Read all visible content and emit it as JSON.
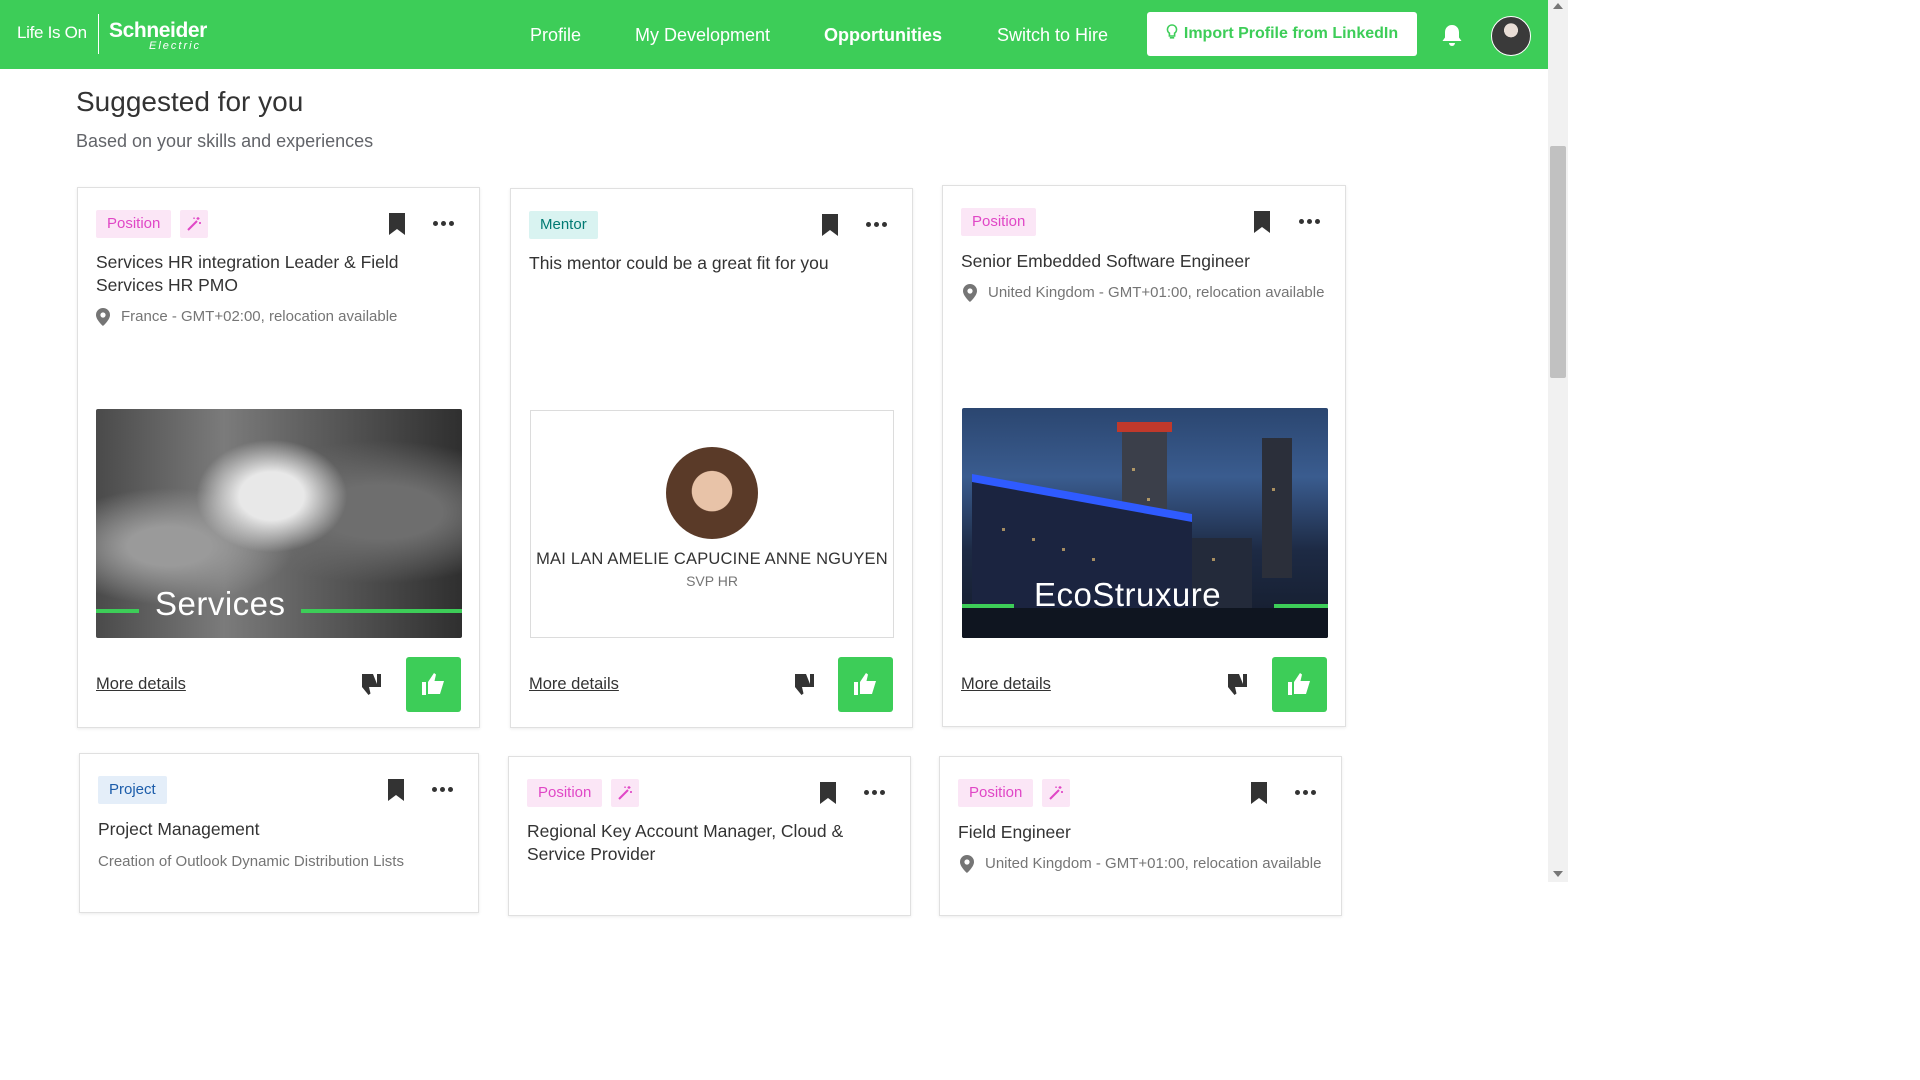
{
  "nav": {
    "brand_tagline": "Life Is On",
    "brand_name": "Schneider",
    "brand_sub": "Electric",
    "items": [
      {
        "label": "Profile"
      },
      {
        "label": "My Development"
      },
      {
        "label": "Opportunities"
      },
      {
        "label": "Switch to Hire"
      }
    ],
    "active_item": "Opportunities",
    "import_button": "Import Profile from LinkedIn",
    "accent_color": "#3dcd58"
  },
  "section": {
    "title": "Suggested for you",
    "subtitle": "Based on your skills and experiences"
  },
  "cards": [
    {
      "badge": "Position",
      "title": "Services HR integration Leader & Field Services HR PMO",
      "location": "France - GMT+02:00, relocation available",
      "image_text": "Services",
      "more_details": "More details"
    },
    {
      "badge": "Mentor",
      "title": "This mentor could be a great fit for you",
      "mentor_name": "MAI LAN AMELIE CAPUCINE ANNE NGUYEN",
      "mentor_role": "SVP HR",
      "more_details": "More details"
    },
    {
      "badge": "Position",
      "title": "Senior Embedded Software Engineer",
      "location": "United Kingdom - GMT+01:00, relocation available",
      "image_text": "EcoStruxure",
      "more_details": "More details"
    },
    {
      "badge": "Project",
      "title": "Project Management",
      "description": "Creation of Outlook Dynamic Distribution Lists"
    },
    {
      "badge": "Position",
      "title": "Regional Key Account Manager, Cloud & Service Provider"
    },
    {
      "badge": "Position",
      "title": "Field Engineer",
      "location": "United Kingdom - GMT+01:00, relocation available"
    }
  ]
}
